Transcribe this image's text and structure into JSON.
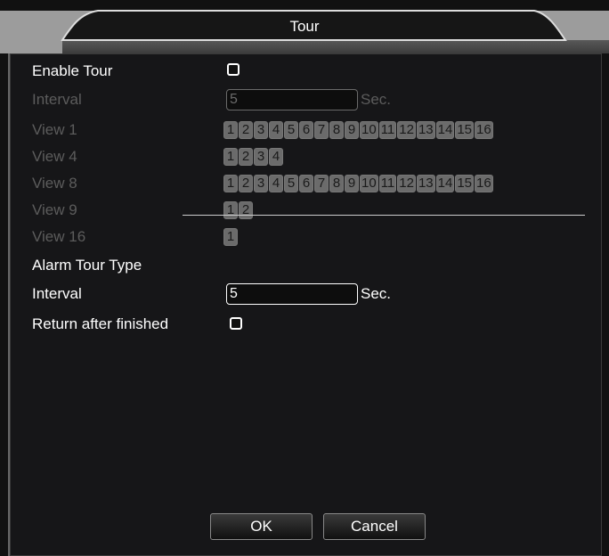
{
  "window": {
    "title": "Tour"
  },
  "enable_tour": {
    "label": "Enable Tour",
    "checked": false
  },
  "interval_top": {
    "label": "Interval",
    "value": "5",
    "unit": "Sec."
  },
  "views": [
    {
      "label": "View 1",
      "channels": [
        "1",
        "2",
        "3",
        "4",
        "5",
        "6",
        "7",
        "8",
        "9",
        "10",
        "11",
        "12",
        "13",
        "14",
        "15",
        "16"
      ]
    },
    {
      "label": "View 4",
      "channels": [
        "1",
        "2",
        "3",
        "4"
      ]
    },
    {
      "label": "View 8",
      "channels": [
        "1",
        "2",
        "3",
        "4",
        "5",
        "6",
        "7",
        "8",
        "9",
        "10",
        "11",
        "12",
        "13",
        "14",
        "15",
        "16"
      ]
    },
    {
      "label": "View 9",
      "channels": [
        "1",
        "2"
      ]
    },
    {
      "label": "View 16",
      "channels": [
        "1"
      ]
    }
  ],
  "alarm_tour_type": {
    "label": "Alarm Tour Type"
  },
  "interval_alarm": {
    "label": "Interval",
    "value": "5",
    "unit": "Sec."
  },
  "return_after_finished": {
    "label": "Return after finished",
    "checked": false
  },
  "buttons": {
    "ok": "OK",
    "cancel": "Cancel"
  }
}
